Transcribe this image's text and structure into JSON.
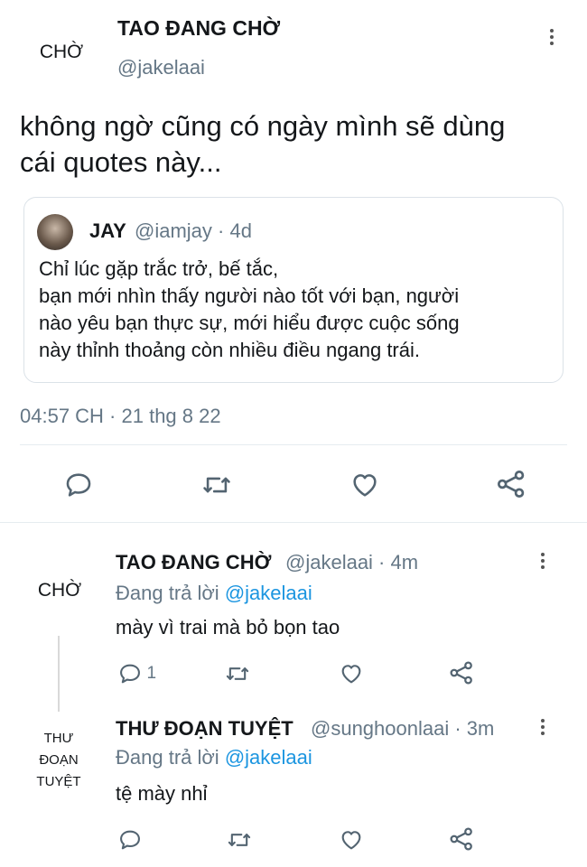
{
  "main_tweet": {
    "avatar_text": "CHỜ",
    "display_name": "TAO ĐANG CHỜ",
    "handle": "@jakelaai",
    "text_line1": "không ngờ cũng có ngày mình sẽ dùng",
    "text_line2": "cái quotes này...",
    "timestamp": "04:57 CH · 21 thg 8 22"
  },
  "quoted_tweet": {
    "display_name": "JAY",
    "handle_time": "@iamjay · 4d",
    "lines": [
      "Chỉ lúc gặp trắc trở, bế tắc,",
      "bạn mới nhìn thấy người nào tốt với bạn, người",
      "nào yêu bạn thực sự, mới hiểu được cuộc sống",
      "này thỉnh thoảng còn nhiều điều ngang trái."
    ]
  },
  "replies": [
    {
      "avatar_text": "CHỜ",
      "display_name": "TAO ĐANG CHỜ",
      "meta": "@jakelaai · 4m",
      "replying_to": "Đang trả lời",
      "replying_handle": "@jakelaai",
      "text": "mày vì trai mà bỏ bọn tao",
      "reply_count": "1"
    },
    {
      "avatar_lines": [
        "THƯ",
        "ĐOẠN",
        "TUYỆT"
      ],
      "display_name": "THƯ ĐOẠN TUYỆT",
      "meta": "@sunghoonlaai · 3m",
      "replying_to": "Đang trả lời",
      "replying_handle": "@jakelaai",
      "text": "tệ mày nhỉ"
    }
  ],
  "icons": [
    "reply-icon",
    "retweet-icon",
    "like-icon",
    "share-icon",
    "more-icon"
  ]
}
